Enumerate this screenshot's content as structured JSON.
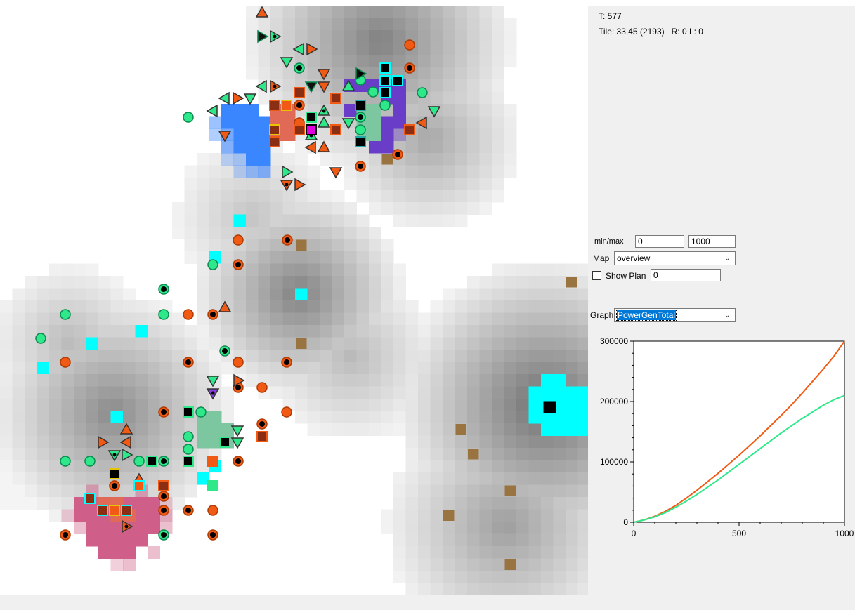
{
  "status": {
    "t_line": "T: 577",
    "tile_line": "Tile: 33,45 (2193)   R: 0 L: 0"
  },
  "controls": {
    "minmax_label": "min/max",
    "min_value": "0",
    "max_value": "1000",
    "map_label": "Map",
    "map_selected": "overview",
    "show_plan_label": "Show Plan",
    "show_plan_checked": false,
    "show_plan_value": "0",
    "graph_label": "Graph:",
    "graph_selected": "PowerGenTotal"
  },
  "colors": {
    "orange_team": "#f05a14",
    "green_team": "#2ee88a",
    "cyan": "#00ffff",
    "blue_zone": "#3a86ff",
    "purple_zone": "#6a3dc8",
    "pink_zone": "#cf5f88",
    "resource": "#9a7440"
  },
  "chart_data": {
    "type": "line",
    "title": "",
    "xlabel": "",
    "ylabel": "",
    "xlim": [
      0,
      1000
    ],
    "ylim": [
      0,
      300000
    ],
    "xticks": [
      "0",
      "500",
      "1000"
    ],
    "yticks": [
      "0",
      "100000",
      "200000",
      "300000"
    ],
    "x": [
      0,
      50,
      100,
      150,
      200,
      250,
      300,
      350,
      400,
      450,
      500,
      550,
      600,
      650,
      700,
      750,
      800,
      850,
      900,
      950,
      1000
    ],
    "series": [
      {
        "color": "#f05a14",
        "values": [
          0,
          4000,
          10000,
          18000,
          28000,
          40000,
          53000,
          67000,
          81000,
          96000,
          111000,
          127000,
          143000,
          160000,
          177000,
          195000,
          214000,
          234000,
          254000,
          275000,
          300000
        ]
      },
      {
        "color": "#2ee88a",
        "values": [
          0,
          4000,
          9000,
          16000,
          25000,
          35000,
          46000,
          58000,
          70000,
          83000,
          96000,
          109000,
          122000,
          135000,
          148000,
          160000,
          172000,
          183000,
          194000,
          203000,
          210000
        ]
      }
    ]
  }
}
